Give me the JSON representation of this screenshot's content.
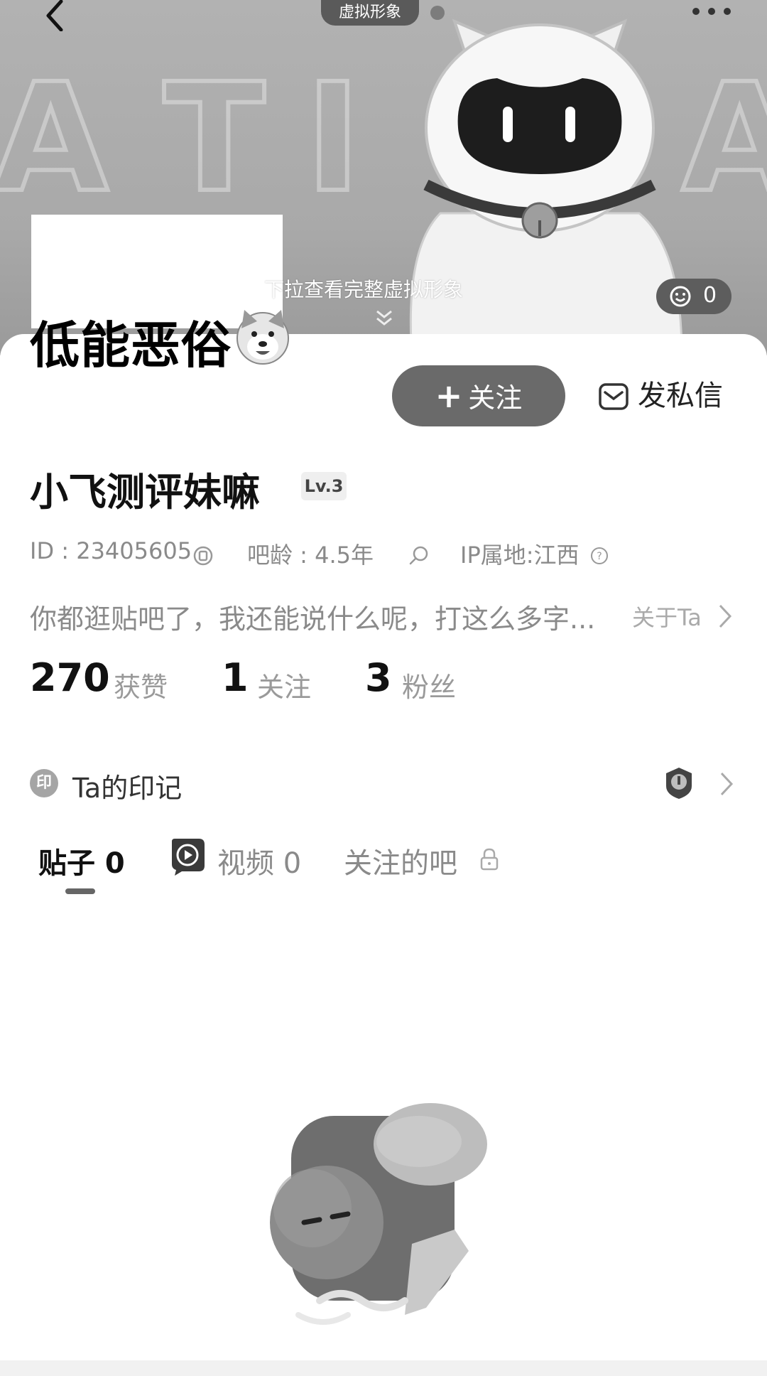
{
  "header": {
    "avatar_tab_label": "虚拟形象",
    "pull_hint": "下拉查看完整虚拟形象",
    "emoji_count": "0",
    "nickname": "低能恶俗"
  },
  "profile": {
    "follow_label": "关注",
    "message_label": "发私信",
    "username": "小飞测评妹嘛",
    "level": "Lv.3",
    "id_text": "ID : 23405605",
    "age_text": "吧龄 : 4.5年",
    "ip_text": "IP属地:江西",
    "bio": "你都逛贴吧了，我还能说什么呢，打这么多字...",
    "about_label": "关于Ta"
  },
  "stats": [
    {
      "value": "270",
      "label": "获赞"
    },
    {
      "value": "1",
      "label": "关注"
    },
    {
      "value": "3",
      "label": "粉丝"
    }
  ],
  "marks": {
    "icon_char": "印",
    "label": "Ta的印记"
  },
  "tabs": [
    {
      "label": "贴子 0"
    },
    {
      "label": "视频 0"
    },
    {
      "label": "关注的吧"
    }
  ],
  "colors": {
    "accent": "#6a6a6a",
    "text": "#111111",
    "muted": "#8a8a8a"
  }
}
